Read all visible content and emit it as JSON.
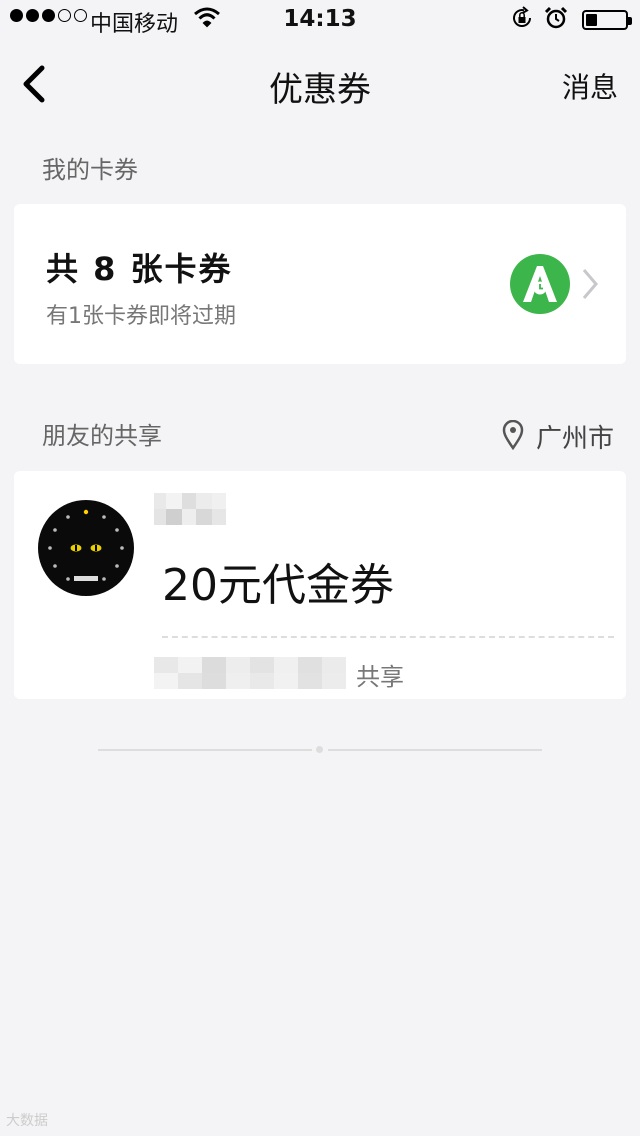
{
  "status_bar": {
    "carrier": "中国移动",
    "time": "14:13",
    "signal_bars_filled": 3,
    "signal_bars_total": 5,
    "battery_level": 0.3,
    "icons": [
      "wifi-icon",
      "rotation-lock-icon",
      "alarm-icon",
      "battery-icon"
    ]
  },
  "nav": {
    "back_icon": "chevron-left-icon",
    "title": "优惠券",
    "right_label": "消息"
  },
  "my_cards": {
    "section_label": "我的卡券",
    "count_text": "共 8 张卡券",
    "expiring_text": "有1张卡券即将过期",
    "logo_color": "#3cb54a",
    "chevron_icon": "chevron-right-icon"
  },
  "friends_share": {
    "section_label": "朋友的共享",
    "location_icon": "location-pin-icon",
    "location": "广州市",
    "item": {
      "title": "20元代金券",
      "share_label": "共享"
    }
  },
  "watermark": "大数据"
}
